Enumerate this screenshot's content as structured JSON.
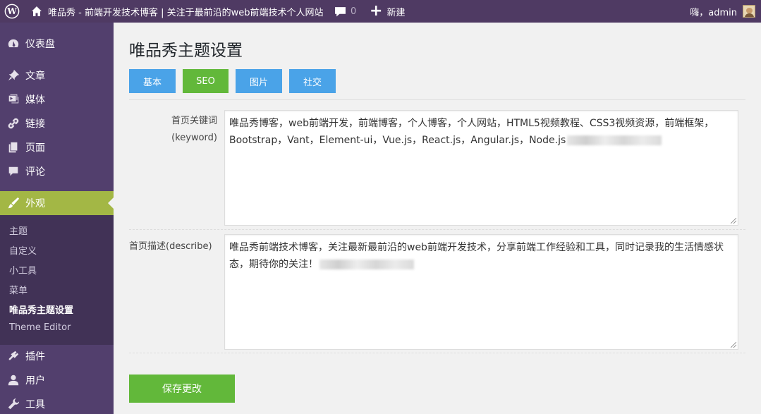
{
  "adminbar": {
    "site_title": "唯品秀 - 前端开发技术博客 | 关注于最前沿的web前端技术个人网站",
    "comments_count": "0",
    "new_label": "新建",
    "greeting": "嗨，admin"
  },
  "sidebar": {
    "items": [
      {
        "label": "仪表盘",
        "icon": "dashboard-icon"
      },
      {
        "label": "文章",
        "icon": "pin-icon"
      },
      {
        "label": "媒体",
        "icon": "media-icon"
      },
      {
        "label": "链接",
        "icon": "link-icon"
      },
      {
        "label": "页面",
        "icon": "page-icon"
      },
      {
        "label": "评论",
        "icon": "comment-icon"
      },
      {
        "label": "外观",
        "icon": "brush-icon"
      },
      {
        "label": "插件",
        "icon": "plugin-icon"
      },
      {
        "label": "用户",
        "icon": "user-icon"
      },
      {
        "label": "工具",
        "icon": "wrench-icon"
      }
    ],
    "submenu": [
      "主题",
      "自定义",
      "小工具",
      "菜单",
      "唯品秀主题设置",
      "Theme Editor"
    ]
  },
  "main": {
    "title": "唯品秀主题设置",
    "tabs": [
      "基本",
      "SEO",
      "图片",
      "社交"
    ],
    "keyword_label": "首页关键词",
    "keyword_label_en": "(keyword)",
    "keyword_value": "唯品秀博客，web前端开发，前端博客，个人博客，个人网站，HTML5视频教程、CSS3视频资源，前端框架，Bootstrap，Vant，Element-ui，Vue.js，React.js，Angular.js，Node.js",
    "describe_label": "首页描述(describe)",
    "describe_value": "唯品秀前端技术博客，关注最新最前沿的web前端开发技术，分享前端工作经验和工具，同时记录我的生活情感状态，期待你的关注！",
    "save_label": "保存更改"
  },
  "colors": {
    "adminbar_bg": "#4f3a63",
    "sidebar_bg": "#523f6d",
    "submenu_bg": "#413256",
    "current_menu": "#a3b745",
    "tab_blue": "#4aa3e8",
    "tab_green": "#62b83a"
  }
}
